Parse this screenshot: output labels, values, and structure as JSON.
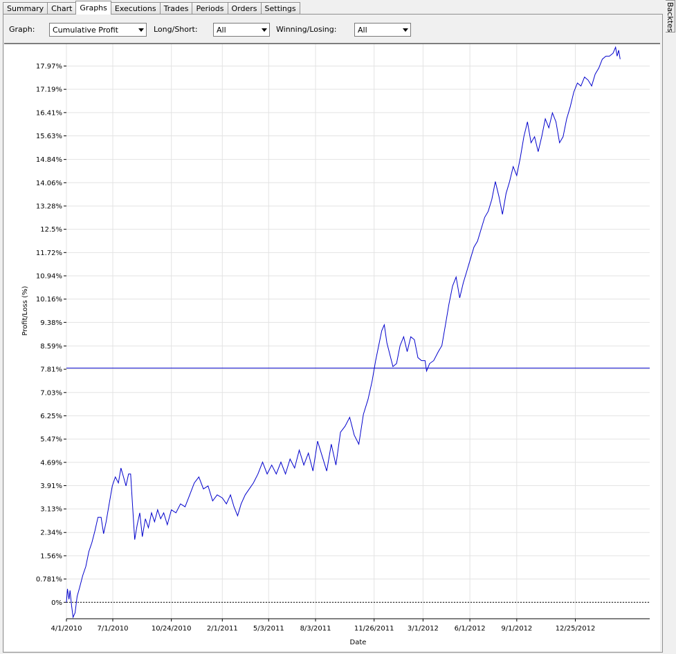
{
  "tabs": [
    {
      "label": "Summary",
      "active": false
    },
    {
      "label": "Chart",
      "active": false
    },
    {
      "label": "Graphs",
      "active": true
    },
    {
      "label": "Executions",
      "active": false
    },
    {
      "label": "Trades",
      "active": false
    },
    {
      "label": "Periods",
      "active": false
    },
    {
      "label": "Orders",
      "active": false
    },
    {
      "label": "Settings",
      "active": false
    }
  ],
  "side_tab": {
    "label": "Backtest"
  },
  "controls": {
    "graph_label": "Graph:",
    "graph_value": "Cumulative Profit",
    "longshort_label": "Long/Short:",
    "longshort_value": "All",
    "winlose_label": "Winning/Losing:",
    "winlose_value": "All"
  },
  "chart_data": {
    "type": "line",
    "xlabel": "Date",
    "ylabel": "Profit/Loss (%)",
    "y_ticks": [
      "0%",
      "0.781%",
      "1.56%",
      "2.34%",
      "3.13%",
      "3.91%",
      "4.69%",
      "5.47%",
      "6.25%",
      "7.03%",
      "7.81%",
      "8.59%",
      "9.38%",
      "10.16%",
      "10.94%",
      "11.72%",
      "12.5%",
      "13.28%",
      "14.06%",
      "14.84%",
      "15.63%",
      "16.41%",
      "17.19%",
      "17.97%"
    ],
    "x_ticks": [
      "4/1/2010",
      "7/1/2010",
      "10/24/2010",
      "2/1/2011",
      "5/3/2011",
      "8/3/2011",
      "11/26/2011",
      "3/1/2012",
      "6/1/2012",
      "9/1/2012",
      "12/25/2012"
    ],
    "x_range": [
      "4/1/2010",
      "5/20/2013"
    ],
    "ylim": [
      -0.55,
      18.7
    ],
    "grid": true,
    "reference_line_y": 7.85,
    "line_color": "#0000cc",
    "series": [
      {
        "points": [
          [
            "4/1/2010",
            0.0
          ],
          [
            "4/3/2010",
            0.45
          ],
          [
            "4/6/2010",
            0.1
          ],
          [
            "4/8/2010",
            0.4
          ],
          [
            "4/11/2010",
            -0.1
          ],
          [
            "4/14/2010",
            -0.5
          ],
          [
            "4/18/2010",
            -0.35
          ],
          [
            "4/22/2010",
            0.2
          ],
          [
            "4/27/2010",
            0.5
          ],
          [
            "5/3/2010",
            0.9
          ],
          [
            "5/9/2010",
            1.2
          ],
          [
            "5/15/2010",
            1.7
          ],
          [
            "5/21/2010",
            2.0
          ],
          [
            "5/27/2010",
            2.4
          ],
          [
            "6/2/2010",
            2.85
          ],
          [
            "6/8/2010",
            2.85
          ],
          [
            "6/13/2010",
            2.3
          ],
          [
            "6/18/2010",
            2.7
          ],
          [
            "6/24/2010",
            3.3
          ],
          [
            "6/30/2010",
            3.9
          ],
          [
            "7/6/2010",
            4.2
          ],
          [
            "7/12/2010",
            4.0
          ],
          [
            "7/17/2010",
            4.5
          ],
          [
            "7/22/2010",
            4.2
          ],
          [
            "7/27/2010",
            3.9
          ],
          [
            "8/1/2010",
            4.3
          ],
          [
            "8/5/2010",
            4.3
          ],
          [
            "8/9/2010",
            3.2
          ],
          [
            "8/13/2010",
            2.1
          ],
          [
            "8/18/2010",
            2.6
          ],
          [
            "8/23/2010",
            3.0
          ],
          [
            "8/28/2010",
            2.2
          ],
          [
            "9/3/2010",
            2.8
          ],
          [
            "9/9/2010",
            2.5
          ],
          [
            "9/15/2010",
            3.0
          ],
          [
            "9/21/2010",
            2.7
          ],
          [
            "9/27/2010",
            3.1
          ],
          [
            "10/3/2010",
            2.8
          ],
          [
            "10/9/2010",
            3.0
          ],
          [
            "10/16/2010",
            2.6
          ],
          [
            "10/24/2010",
            3.1
          ],
          [
            "11/2/2010",
            3.0
          ],
          [
            "11/11/2010",
            3.3
          ],
          [
            "11/20/2010",
            3.2
          ],
          [
            "11/29/2010",
            3.6
          ],
          [
            "12/8/2010",
            4.0
          ],
          [
            "12/17/2010",
            4.2
          ],
          [
            "12/26/2010",
            3.8
          ],
          [
            "1/4/2011",
            3.9
          ],
          [
            "1/13/2011",
            3.4
          ],
          [
            "1/22/2011",
            3.6
          ],
          [
            "2/1/2011",
            3.5
          ],
          [
            "2/9/2011",
            3.3
          ],
          [
            "2/17/2011",
            3.6
          ],
          [
            "2/24/2011",
            3.2
          ],
          [
            "3/3/2011",
            2.9
          ],
          [
            "3/10/2011",
            3.3
          ],
          [
            "3/18/2011",
            3.6
          ],
          [
            "3/26/2011",
            3.8
          ],
          [
            "4/3/2011",
            4.0
          ],
          [
            "4/12/2011",
            4.3
          ],
          [
            "4/21/2011",
            4.7
          ],
          [
            "4/30/2011",
            4.3
          ],
          [
            "5/9/2011",
            4.6
          ],
          [
            "5/18/2011",
            4.3
          ],
          [
            "5/27/2011",
            4.7
          ],
          [
            "6/5/2011",
            4.3
          ],
          [
            "6/14/2011",
            4.8
          ],
          [
            "6/23/2011",
            4.5
          ],
          [
            "7/2/2011",
            5.1
          ],
          [
            "7/11/2011",
            4.6
          ],
          [
            "7/20/2011",
            5.0
          ],
          [
            "7/29/2011",
            4.4
          ],
          [
            "8/7/2011",
            5.4
          ],
          [
            "8/16/2011",
            4.9
          ],
          [
            "8/25/2011",
            4.4
          ],
          [
            "9/3/2011",
            5.3
          ],
          [
            "9/12/2011",
            4.6
          ],
          [
            "9/21/2011",
            5.7
          ],
          [
            "9/30/2011",
            5.9
          ],
          [
            "10/9/2011",
            6.2
          ],
          [
            "10/18/2011",
            5.6
          ],
          [
            "10/27/2011",
            5.3
          ],
          [
            "11/5/2011",
            6.3
          ],
          [
            "11/14/2011",
            6.8
          ],
          [
            "11/22/2011",
            7.4
          ],
          [
            "11/29/2011",
            8.1
          ],
          [
            "12/5/2011",
            8.6
          ],
          [
            "12/11/2011",
            9.1
          ],
          [
            "12/16/2011",
            9.3
          ],
          [
            "12/21/2011",
            8.7
          ],
          [
            "12/27/2011",
            8.3
          ],
          [
            "1/2/2012",
            7.9
          ],
          [
            "1/9/2012",
            8.0
          ],
          [
            "1/16/2012",
            8.6
          ],
          [
            "1/23/2012",
            8.9
          ],
          [
            "1/30/2012",
            8.4
          ],
          [
            "2/6/2012",
            8.9
          ],
          [
            "2/13/2012",
            8.8
          ],
          [
            "2/20/2012",
            8.2
          ],
          [
            "2/27/2012",
            8.1
          ],
          [
            "3/5/2012",
            8.1
          ],
          [
            "3/8/2012",
            7.75
          ],
          [
            "3/14/2012",
            8.0
          ],
          [
            "3/22/2012",
            8.1
          ],
          [
            "3/31/2012",
            8.4
          ],
          [
            "4/7/2012",
            8.6
          ],
          [
            "4/14/2012",
            9.3
          ],
          [
            "4/21/2012",
            10.0
          ],
          [
            "4/28/2012",
            10.6
          ],
          [
            "5/5/2012",
            10.9
          ],
          [
            "5/12/2012",
            10.2
          ],
          [
            "5/19/2012",
            10.7
          ],
          [
            "5/26/2012",
            11.1
          ],
          [
            "6/2/2012",
            11.5
          ],
          [
            "6/9/2012",
            11.9
          ],
          [
            "6/16/2012",
            12.1
          ],
          [
            "6/23/2012",
            12.5
          ],
          [
            "6/30/2012",
            12.9
          ],
          [
            "7/7/2012",
            13.1
          ],
          [
            "7/14/2012",
            13.5
          ],
          [
            "7/21/2012",
            14.1
          ],
          [
            "7/28/2012",
            13.6
          ],
          [
            "8/4/2012",
            13.0
          ],
          [
            "8/11/2012",
            13.7
          ],
          [
            "8/18/2012",
            14.1
          ],
          [
            "8/25/2012",
            14.6
          ],
          [
            "9/1/2012",
            14.3
          ],
          [
            "9/8/2012",
            14.9
          ],
          [
            "9/15/2012",
            15.6
          ],
          [
            "9/22/2012",
            16.1
          ],
          [
            "9/29/2012",
            15.4
          ],
          [
            "10/6/2012",
            15.6
          ],
          [
            "10/13/2012",
            15.1
          ],
          [
            "10/20/2012",
            15.6
          ],
          [
            "10/27/2012",
            16.2
          ],
          [
            "11/3/2012",
            15.9
          ],
          [
            "11/10/2012",
            16.4
          ],
          [
            "11/17/2012",
            16.1
          ],
          [
            "11/24/2012",
            15.4
          ],
          [
            "12/1/2012",
            15.6
          ],
          [
            "12/8/2012",
            16.2
          ],
          [
            "12/15/2012",
            16.6
          ],
          [
            "12/22/2012",
            17.1
          ],
          [
            "12/29/2012",
            17.4
          ],
          [
            "1/5/2013",
            17.3
          ],
          [
            "1/12/2013",
            17.6
          ],
          [
            "1/19/2013",
            17.5
          ],
          [
            "1/26/2013",
            17.3
          ],
          [
            "2/2/2013",
            17.7
          ],
          [
            "2/9/2013",
            17.9
          ],
          [
            "2/16/2013",
            18.2
          ],
          [
            "2/23/2013",
            18.3
          ],
          [
            "3/2/2013",
            18.3
          ],
          [
            "3/9/2013",
            18.4
          ],
          [
            "3/14/2013",
            18.6
          ],
          [
            "3/17/2013",
            18.3
          ],
          [
            "3/20/2013",
            18.5
          ],
          [
            "3/23/2013",
            18.2
          ]
        ]
      }
    ]
  }
}
